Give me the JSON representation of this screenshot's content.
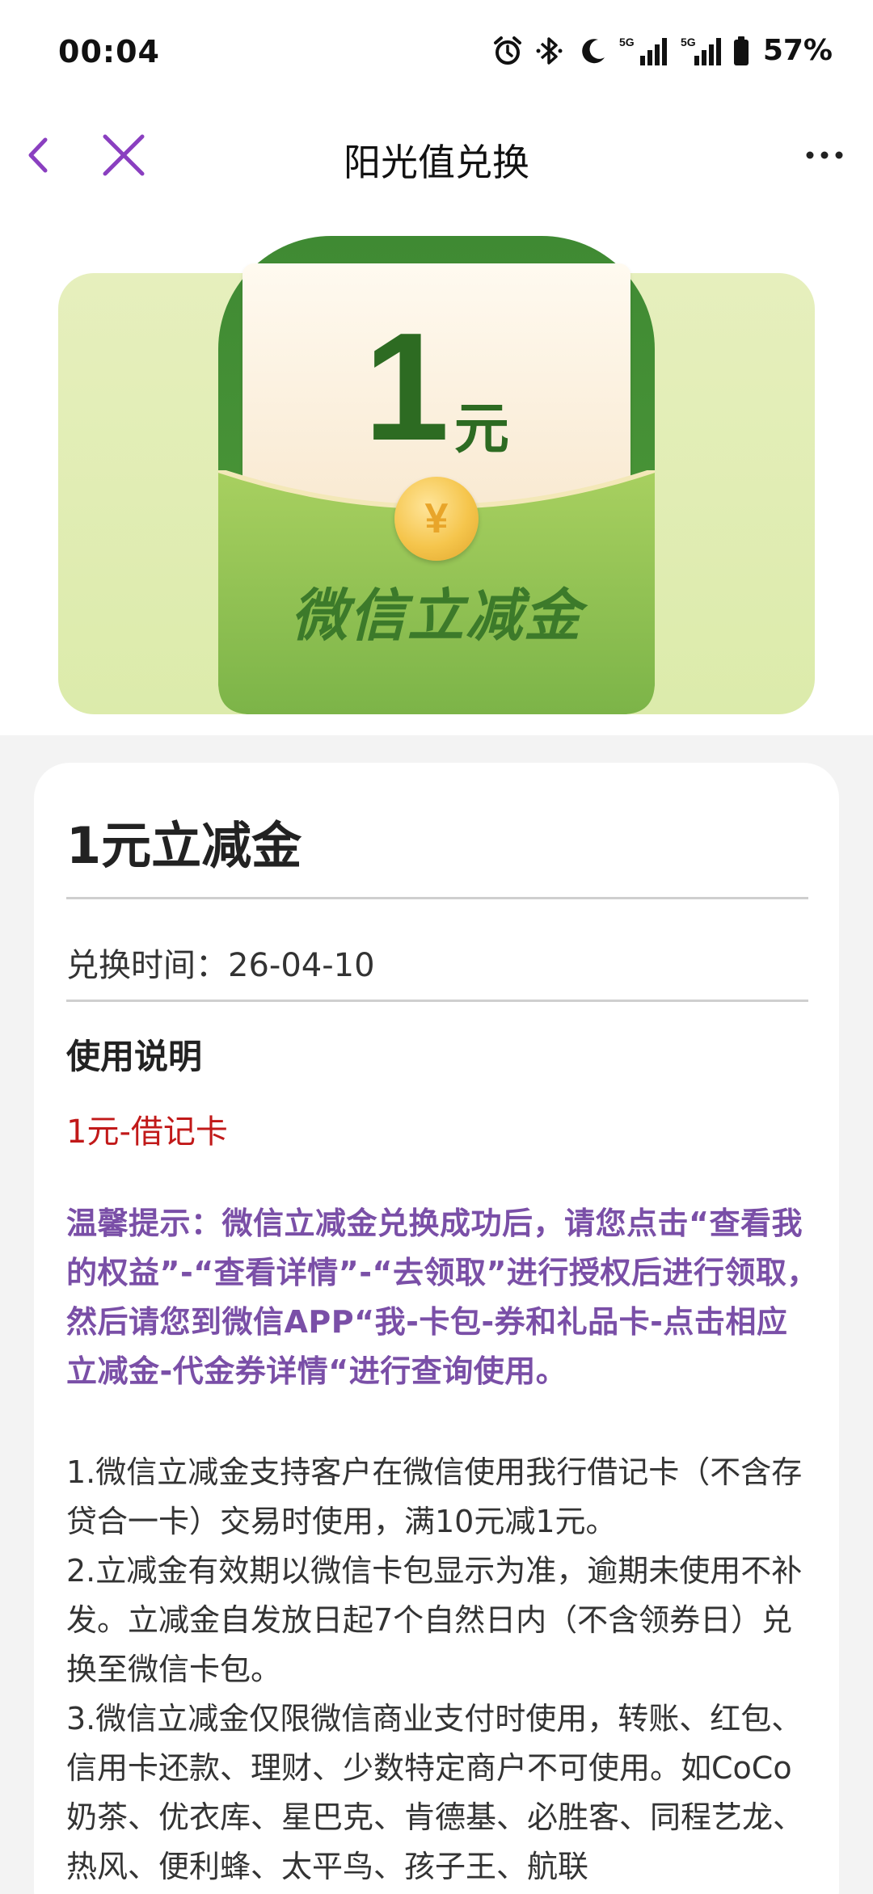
{
  "status_bar": {
    "time": "00:04",
    "signal_1": "5G",
    "signal_2": "5G",
    "battery": "57%",
    "icons": [
      "alarm-icon",
      "bluetooth-icon",
      "do-not-disturb-moon-icon",
      "signal-5g-icon",
      "signal-5g-icon",
      "battery-icon"
    ]
  },
  "nav": {
    "title": "阳光值兑换",
    "accent_color": "#8a3fc0"
  },
  "banner": {
    "amount": "1",
    "unit": "元",
    "coin_symbol": "¥",
    "label": "微信立减金"
  },
  "card": {
    "title": "1元立减金",
    "exchange_time": "兑换时间：26-04-10",
    "usage_title": "使用说明",
    "card_type": "1元-借记卡",
    "tip": "温馨提示：微信立减金兑换成功后，请您点击“查看我的权益”-“查看详情”-“去领取”进行授权后进行领取，然后请您到微信APP“我-卡包-券和礼品卡-点击相应立减金-代金券详情“进行查询使用。",
    "rules": [
      "1.微信立减金支持客户在微信使用我行借记卡（不含存贷合一卡）交易时使用，满10元减1元。",
      "2.立减金有效期以微信卡包显示为准，逾期未使用不补发。立减金自发放日起7个自然日内（不含领券日）兑换至微信卡包。",
      "3.微信立减金仅限微信商业支付时使用，转账、红包、信用卡还款、理财、少数特定商户不可使用。如CoCo奶茶、优衣库、星巴克、肯德基、必胜客、同程艺龙、热风、便利蜂、太平鸟、孩子王、航联"
    ]
  }
}
